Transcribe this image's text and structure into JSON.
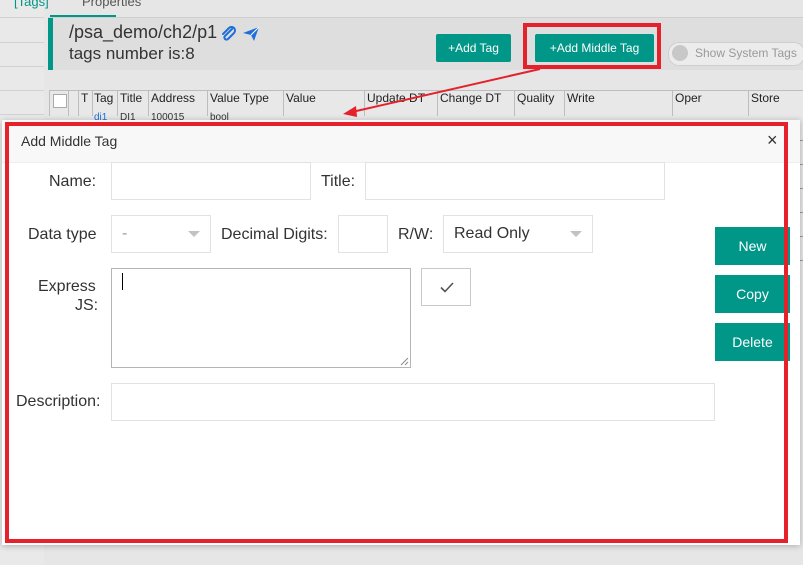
{
  "tabs": [
    {
      "label": "[Tags]"
    },
    {
      "label": "Properties"
    }
  ],
  "header": {
    "path": "/psa_demo/ch2/p1",
    "tags_count": "tags number is:8",
    "add_tag": "+Add Tag",
    "add_middle_tag": "+Add Middle Tag",
    "show_system_tags": "Show System Tags"
  },
  "table": {
    "columns": [
      "T",
      "Tag",
      "Title",
      "Address",
      "Value Type",
      "Value",
      "Update DT",
      "Change DT",
      "Quality",
      "Write",
      "Oper",
      "Store"
    ],
    "row1": {
      "tag": "di1",
      "title": "DI1",
      "address": "100015",
      "value_type": "bool"
    }
  },
  "dialog": {
    "title": "Add Middle Tag",
    "close": "×",
    "name_label": "Name:",
    "name_value": "",
    "title_label": "Title:",
    "title_value": "",
    "data_type_label": "Data type",
    "data_type_value": "-",
    "decimal_label": "Decimal Digits:",
    "decimal_value": "",
    "rw_label": "R/W:",
    "rw_value": "Read Only",
    "express_label_1": "Express",
    "express_label_2": "JS:",
    "express_value": "",
    "check_icon": "check-icon",
    "description_label": "Description:",
    "description_value": "",
    "buttons": {
      "new": "New",
      "copy": "Copy",
      "delete": "Delete"
    }
  },
  "colors": {
    "accent": "#009688",
    "highlight": "#e5212c"
  }
}
